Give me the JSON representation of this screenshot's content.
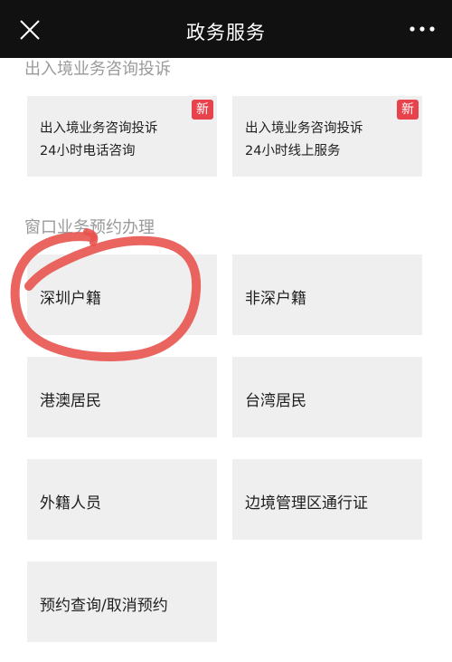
{
  "header": {
    "title": "政务服务",
    "close_icon": "close-icon",
    "more_icon": "more-dots-icon"
  },
  "sections": [
    {
      "title": "出入境业务咨询投诉",
      "cards": [
        {
          "line1": "出入境业务咨询投诉",
          "line2": "24小时电话咨询",
          "badge": "新"
        },
        {
          "line1": "出入境业务咨询投诉",
          "line2": "24小时线上服务",
          "badge": "新"
        }
      ]
    },
    {
      "title": "窗口业务预约办理",
      "cards": [
        {
          "label": "深圳户籍"
        },
        {
          "label": "非深户籍"
        },
        {
          "label": "港澳居民"
        },
        {
          "label": "台湾居民"
        },
        {
          "label": "外籍人员"
        },
        {
          "label": "边境管理区通行证"
        },
        {
          "label": "预约查询/取消预约"
        }
      ]
    }
  ],
  "colors": {
    "header_bg": "#111111",
    "card_bg": "#efefef",
    "badge": "#e8434c",
    "annotation_circle": "#e8534f"
  }
}
